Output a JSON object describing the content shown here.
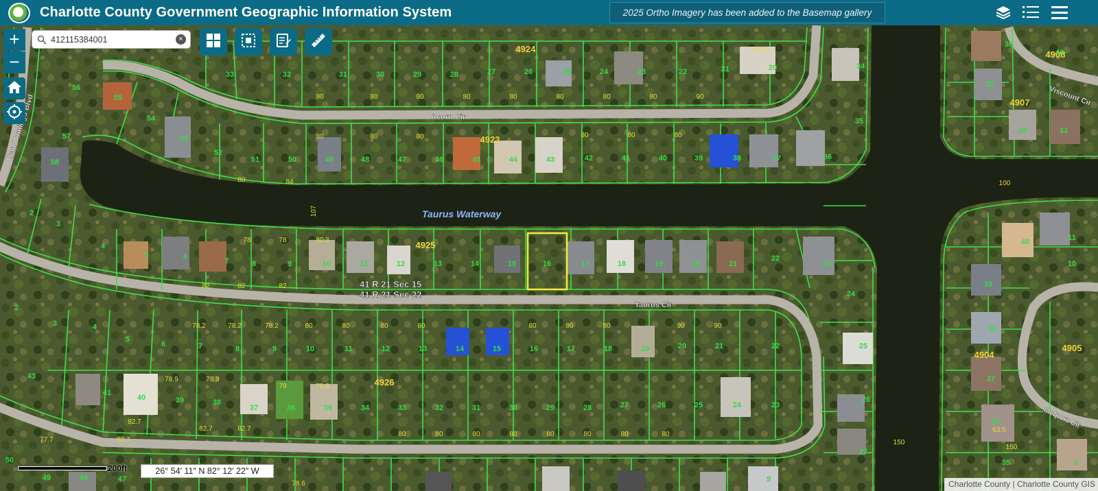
{
  "header": {
    "title": "Charlotte County Government Geographic Information System",
    "banner": "2025 Ortho Imagery has been added to the Basemap gallery",
    "icons": [
      "layers-icon",
      "list-icon",
      "menu-icon"
    ],
    "color": "#0b6b86"
  },
  "search": {
    "value": "412115384001",
    "placeholder": "",
    "clear_label": "×"
  },
  "zoom": {
    "in_label": "+",
    "out_label": "−"
  },
  "toolbar": {
    "tools": [
      "grid-select-icon",
      "dashed-select-icon",
      "edit-notes-icon",
      "measure-ruler-icon"
    ]
  },
  "side_buttons": [
    "home-icon",
    "locate-icon"
  ],
  "map": {
    "streets": [
      "Acorn Cir",
      "Taurus Cir",
      "Viscount Cir",
      "Melport Cir",
      "San Domingo Blvd"
    ],
    "waterway": "Taurus Waterway",
    "sections": [
      "41 R 21 Sec 15",
      "41 R 21 Sec 22"
    ],
    "blocks": [
      "4924",
      "4923",
      "4925",
      "4926",
      "4908",
      "4907",
      "4904",
      "4905"
    ],
    "highlighted_lot": "16",
    "parcel_line_color": "#3fe04a",
    "highlight_color": "#f5ef3b",
    "water_color": "#1c2314"
  },
  "scale": {
    "label": "200ft"
  },
  "coordinates": {
    "text": "26° 54′ 11″ N 82° 12′ 22″ W"
  },
  "attribution": "Charlotte County | Charlotte County GIS"
}
